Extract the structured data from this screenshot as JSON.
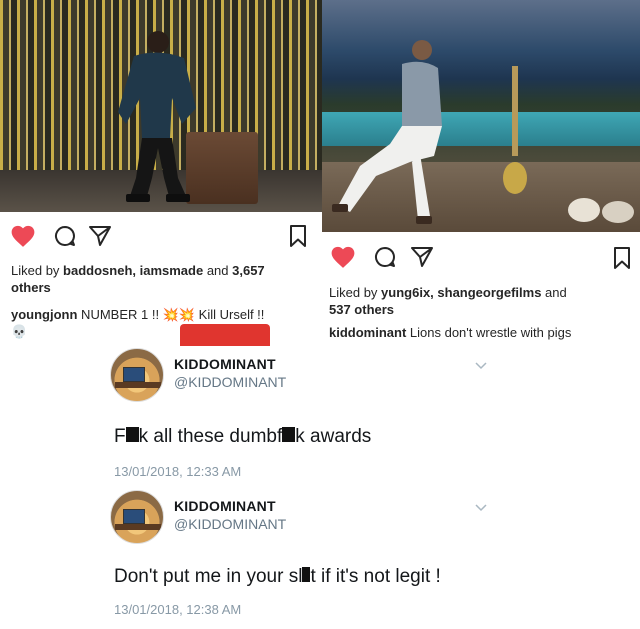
{
  "post_left": {
    "likes_text_prefix": "Liked by ",
    "likes_users": "baddosneh, iamsmade",
    "likes_and": " and ",
    "likes_count": "3,657",
    "likes_suffix": "others",
    "caption_user": "youngjonn",
    "caption_text": " NUMBER 1 !! ",
    "caption_emoji": "💥💥",
    "caption_text2": " Kill Urself !!",
    "caption_emoji2": "💀"
  },
  "post_right": {
    "likes_text_prefix": "Liked by ",
    "likes_users": "yung6ix, shangeorgefilms",
    "likes_and": " and",
    "likes_count_line": "537 others",
    "caption_user": "kiddominant",
    "caption_text": " Lions don't wrestle with pigs"
  },
  "tweets": [
    {
      "name": "KIDDOMINANT",
      "handle": "@KIDDOMINANT",
      "text_a": "F",
      "text_b": "k all these dumbf",
      "text_c": "k awards",
      "time": "13/01/2018, 12:33 AM"
    },
    {
      "name": "KIDDOMINANT",
      "handle": "@KIDDOMINANT",
      "text_a": "Don't put me in your sl",
      "text_b": "t if it's not legit !",
      "time": "13/01/2018, 12:38 AM"
    }
  ],
  "colors": {
    "heart": "#ed4956",
    "follow_button": "#e0352f",
    "tweet_meta": "#8899a6"
  },
  "icons": [
    "heart-icon",
    "comment-icon",
    "share-icon",
    "bookmark-icon",
    "chevron-down-icon"
  ]
}
